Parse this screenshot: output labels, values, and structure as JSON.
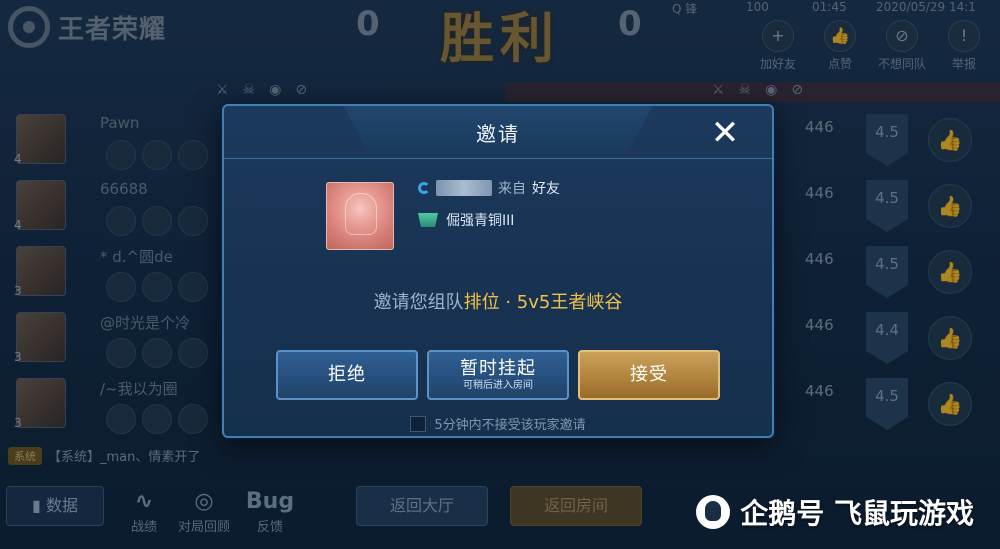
{
  "game": {
    "logo_text": "王者荣耀",
    "score_left": "0",
    "score_right": "0",
    "victory_banner": "胜利",
    "top_meta": [
      "Q 锋",
      "100",
      "01:45",
      "2020/05/29 14:1"
    ]
  },
  "top_actions": [
    {
      "label": "加好友",
      "icon": "add-friend-icon"
    },
    {
      "label": "点赞",
      "icon": "thumb-up-icon"
    },
    {
      "label": "不想同队",
      "icon": "block-icon"
    },
    {
      "label": "举报",
      "icon": "warning-icon"
    }
  ],
  "players": [
    {
      "name": "Pawn",
      "level": "4",
      "stat": "446",
      "rating": "4.5"
    },
    {
      "name": "66688",
      "level": "4",
      "stat": "446",
      "rating": "4.5"
    },
    {
      "name": "* d.^圆de",
      "level": "3",
      "stat": "446",
      "rating": "4.5"
    },
    {
      "name": "@时光是个冷",
      "level": "3",
      "stat": "446",
      "rating": "4.4"
    },
    {
      "name": "/~我以为圈",
      "level": "3",
      "stat": "446",
      "rating": "4.5"
    }
  ],
  "system_message": {
    "tag": "系统",
    "text": "【系统】_man、情素开了"
  },
  "bottom": {
    "data_button": "数据",
    "tools": [
      {
        "label": "战绩",
        "icon": "trend-icon"
      },
      {
        "label": "对局回顾",
        "icon": "replay-icon"
      },
      {
        "label": "反馈",
        "icon": "bug-icon",
        "glyph": "Bug"
      }
    ],
    "back_to_hall": "返回大厅",
    "back_to_room": "返回房间"
  },
  "watermark": "企鹅号 飞鼠玩游戏",
  "dialog": {
    "title": "邀请",
    "from_text": "来自",
    "friend_text": "好友",
    "rank": "倔强青铜III",
    "invite_prefix": "邀请您组队",
    "invite_mode": "排位 · 5v5王者峡谷",
    "reject_label": "拒绝",
    "suspend_label": "暂时挂起",
    "suspend_sub": "可稍后进入房间",
    "accept_label": "接受",
    "checkbox_label": "5分钟内不接受该玩家邀请",
    "checkbox_checked": false
  }
}
